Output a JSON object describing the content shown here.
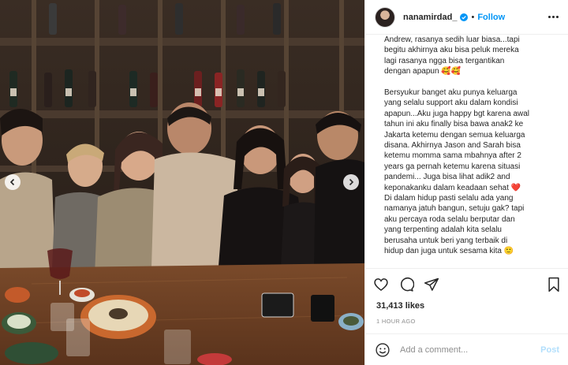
{
  "post": {
    "username": "nanamirdad_",
    "follow_label": "Follow",
    "separator": "•",
    "caption_lines_block1": [
      "Andrew, rasanya sedih luar biasa...tapi",
      "begitu akhirnya aku bisa peluk mereka",
      "lagi rasanya ngga bisa tergantikan",
      "dengan apapun 🥰🥰"
    ],
    "caption_lines_block2": [
      "Bersyukur banget aku punya keluarga",
      "yang selalu support aku dalam kondisi",
      "apapun...Aku juga happy bgt karena awal",
      "tahun ini aku finally bisa bawa anak2 ke",
      "Jakarta ketemu dengan semua keluarga",
      "disana. Akhirnya Jason and Sarah bisa",
      "ketemu momma sama mbahnya after 2",
      "years ga pernah ketemu karena situasi",
      "pandemi... Juga bisa lihat adik2 and",
      "keponakanku dalam keadaan sehat ❤️",
      "Di dalam hidup pasti selalu ada yang",
      "namanya jatuh bangun, setuju gak? tapi",
      "aku percaya roda selalu berputar dan",
      "yang terpenting adalah kita selalu",
      "berusaha untuk beri yang terbaik di",
      "hidup dan juga untuk sesama kita 🙂"
    ],
    "likes": "31,413 likes",
    "time": "1 HOUR AGO",
    "comment_placeholder": "Add a comment...",
    "post_label": "Post"
  },
  "icons": {
    "verified": "verified-badge-icon",
    "more": "more-options-icon",
    "like": "heart-icon",
    "comment": "comment-icon",
    "share": "share-icon",
    "save": "bookmark-icon",
    "emoji": "emoji-icon",
    "prev": "chevron-left-icon",
    "next": "chevron-right-icon"
  },
  "colors": {
    "accent": "#0095f6",
    "post_disabled": "#b2dffc",
    "muted": "#8e8e8e",
    "text": "#262626",
    "border": "#efefef"
  }
}
